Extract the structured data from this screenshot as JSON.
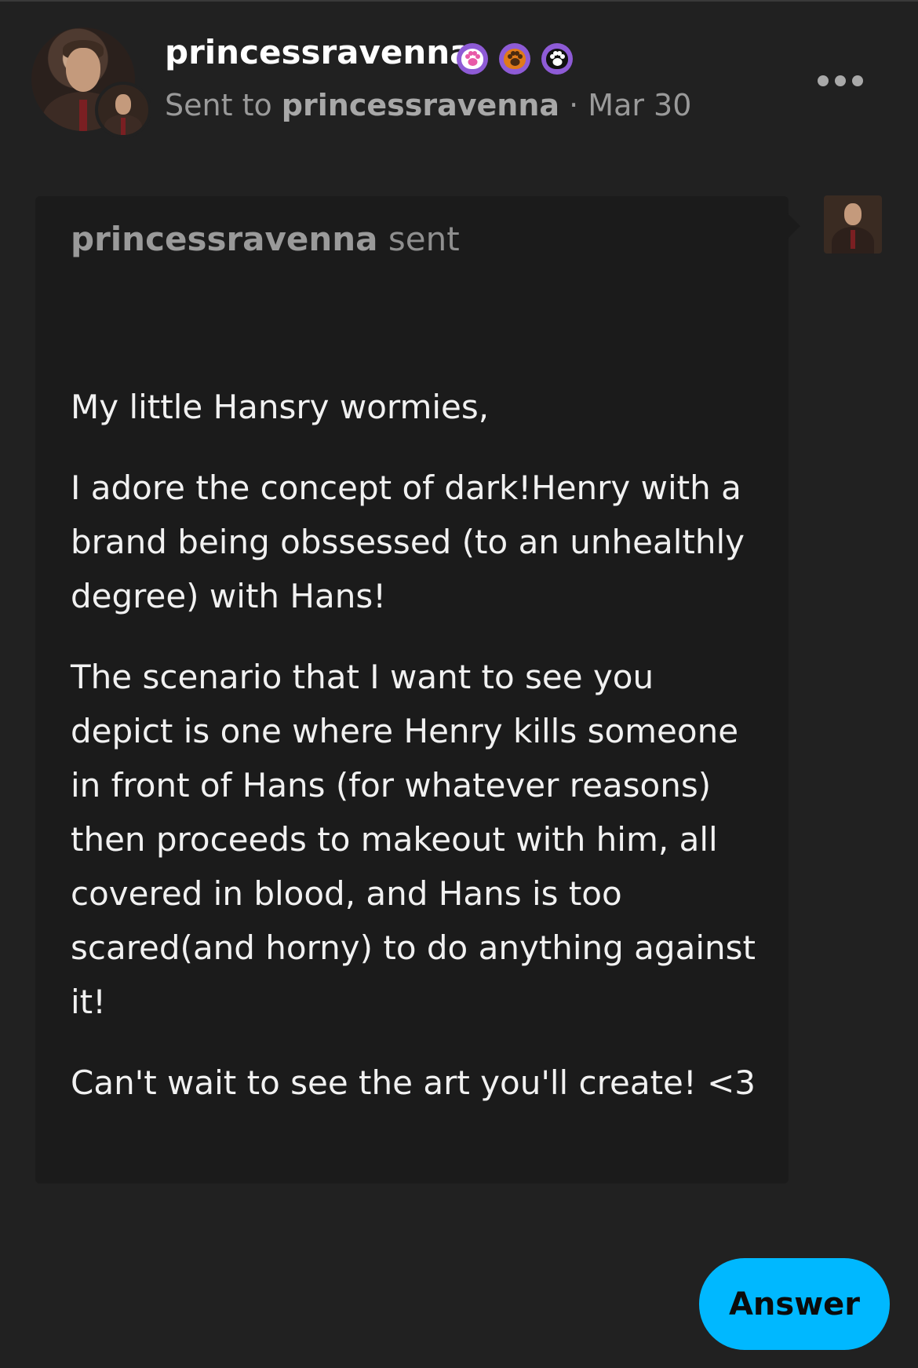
{
  "header": {
    "username": "princessravenna",
    "sent_to_prefix": "Sent to ",
    "recipient": "princessravenna",
    "date_separator": " · ",
    "date": "Mar 30",
    "badges": [
      {
        "icon": "paw-pink-icon",
        "color": "#e85aa8"
      },
      {
        "icon": "paw-orange-icon",
        "color": "#e07a1a"
      },
      {
        "icon": "paw-black-icon",
        "color": "#111111"
      }
    ],
    "more_icon": "more-horizontal-icon"
  },
  "ask": {
    "asker": "princessravenna",
    "verb": " sent",
    "paragraphs": [
      "My little Hansry wormies,",
      "I adore the concept of dark!Henry with a brand being obssessed (to an unhealthly degree) with Hans!",
      "The scenario that I want to see you depict is one where Henry kills someone in front of Hans (for whatever reasons) then proceeds to makeout with him, all covered in blood, and Hans is too scared(and horny) to do anything against it!",
      "Can't wait to see the art you'll create! <3"
    ]
  },
  "actions": {
    "answer_label": "Answer"
  },
  "colors": {
    "background": "#212121",
    "bubble": "#1b1b1b",
    "accent": "#00b8ff",
    "badge_ring": "#8e5bd6"
  }
}
